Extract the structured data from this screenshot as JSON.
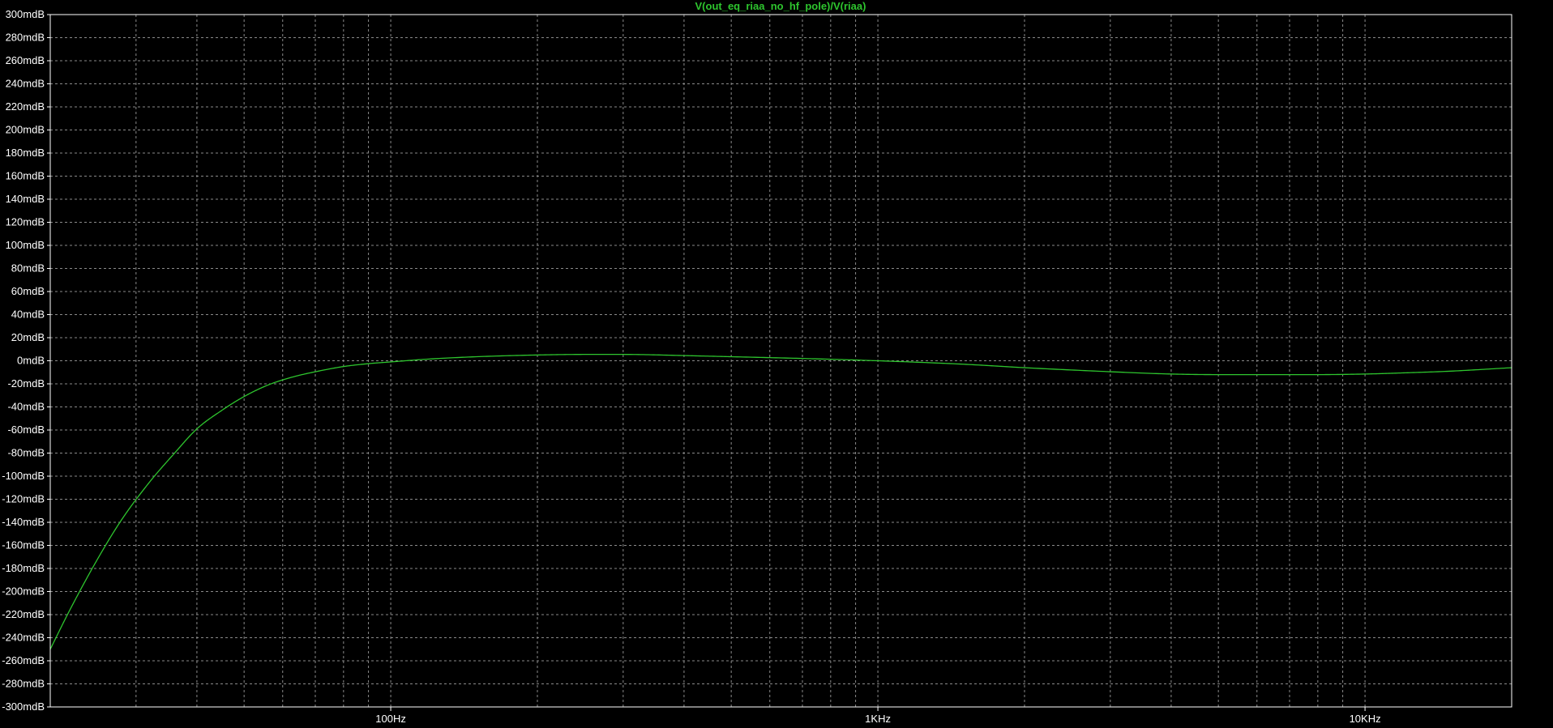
{
  "colors": {
    "background": "#000000",
    "frame": "#ffffff",
    "grid": "#8a8a8a",
    "trace": "#2ec52e",
    "tick_label": "#ffffff"
  },
  "chart_data": {
    "type": "line",
    "title": "V(out_eq_riaa_no_hf_pole)/V(riaa)",
    "xlabel": "",
    "ylabel": "",
    "x_scale": "log",
    "xlim": [
      20,
      20000
    ],
    "ylim": [
      -300,
      300
    ],
    "grid": true,
    "y_ticks": [
      300,
      280,
      260,
      240,
      220,
      200,
      180,
      160,
      140,
      120,
      100,
      80,
      60,
      40,
      20,
      0,
      -20,
      -40,
      -60,
      -80,
      -100,
      -120,
      -140,
      -160,
      -180,
      -200,
      -220,
      -240,
      -260,
      -280,
      -300
    ],
    "y_tick_labels": [
      "300mdB",
      "280mdB",
      "260mdB",
      "240mdB",
      "220mdB",
      "200mdB",
      "180mdB",
      "160mdB",
      "140mdB",
      "120mdB",
      "100mdB",
      "80mdB",
      "60mdB",
      "40mdB",
      "20mdB",
      "0mdB",
      "-20mdB",
      "-40mdB",
      "-60mdB",
      "-80mdB",
      "-100mdB",
      "-120mdB",
      "-140mdB",
      "-160mdB",
      "-180mdB",
      "-200mdB",
      "-220mdB",
      "-240mdB",
      "-260mdB",
      "-280mdB",
      "-300mdB"
    ],
    "x_ticks": [
      100,
      1000,
      10000
    ],
    "x_tick_labels": [
      "100Hz",
      "1KHz",
      "10KHz"
    ],
    "series": [
      {
        "name": "V(out_eq_riaa_no_hf_pole)/V(riaa)",
        "x": [
          20,
          22,
          25,
          28,
          32,
          36,
          40,
          45,
          50,
          56,
          63,
          71,
          80,
          90,
          100,
          120,
          150,
          200,
          250,
          300,
          400,
          500,
          700,
          1000,
          1500,
          2000,
          3000,
          4000,
          5000,
          6000,
          7000,
          8000,
          10000,
          12000,
          15000,
          20000
        ],
        "y": [
          -250,
          -215,
          -172,
          -138,
          -105,
          -80,
          -59,
          -43,
          -31,
          -21,
          -14,
          -9,
          -5,
          -2.5,
          -1,
          1.5,
          3.5,
          5,
          5.5,
          5.5,
          4.5,
          3.5,
          2,
          0,
          -3,
          -6,
          -9.5,
          -11.5,
          -12,
          -12,
          -12,
          -12,
          -11.5,
          -10.5,
          -9,
          -6
        ]
      }
    ]
  }
}
